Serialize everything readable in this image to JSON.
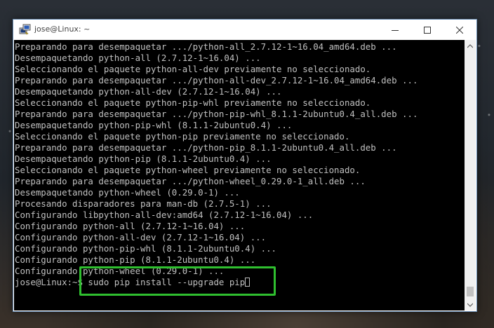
{
  "window": {
    "title": "jose@Linux: ~",
    "icon": "putty-icon"
  },
  "terminal": {
    "lines": [
      "Preparando para desempaquetar .../python-all_2.7.12-1~16.04_amd64.deb ...",
      "Desempaquetando python-all (2.7.12-1~16.04) ...",
      "Seleccionando el paquete python-all-dev previamente no seleccionado.",
      "Preparando para desempaquetar .../python-all-dev_2.7.12-1~16.04_amd64.deb ...",
      "Desempaquetando python-all-dev (2.7.12-1~16.04) ...",
      "Seleccionando el paquete python-pip-whl previamente no seleccionado.",
      "Preparando para desempaquetar .../python-pip-whl_8.1.1-2ubuntu0.4_all.deb ...",
      "Desempaquetando python-pip-whl (8.1.1-2ubuntu0.4) ...",
      "Seleccionando el paquete python-pip previamente no seleccionado.",
      "Preparando para desempaquetar .../python-pip_8.1.1-2ubuntu0.4_all.deb ...",
      "Desempaquetando python-pip (8.1.1-2ubuntu0.4) ...",
      "Seleccionando el paquete python-wheel previamente no seleccionado.",
      "Preparando para desempaquetar .../python-wheel_0.29.0-1_all.deb ...",
      "Desempaquetando python-wheel (0.29.0-1) ...",
      "Procesando disparadores para man-db (2.7.5-1) ...",
      "Configurando libpython-all-dev:amd64 (2.7.12-1~16.04) ...",
      "Configurando python-all (2.7.12-1~16.04) ...",
      "Configurando python-all-dev (2.7.12-1~16.04) ...",
      "Configurando python-pip-whl (8.1.1-2ubuntu0.4) ...",
      "Configurando python-pip (8.1.1-2ubuntu0.4) ...",
      "Configurando python-wheel (0.29.0-1) ..."
    ],
    "prompt": "jose@Linux:~$ sudo pip install --upgrade pip"
  },
  "colors": {
    "terminal_bg": "#000000",
    "terminal_fg": "#c0c0c0",
    "highlight": "#2fbf2f"
  }
}
